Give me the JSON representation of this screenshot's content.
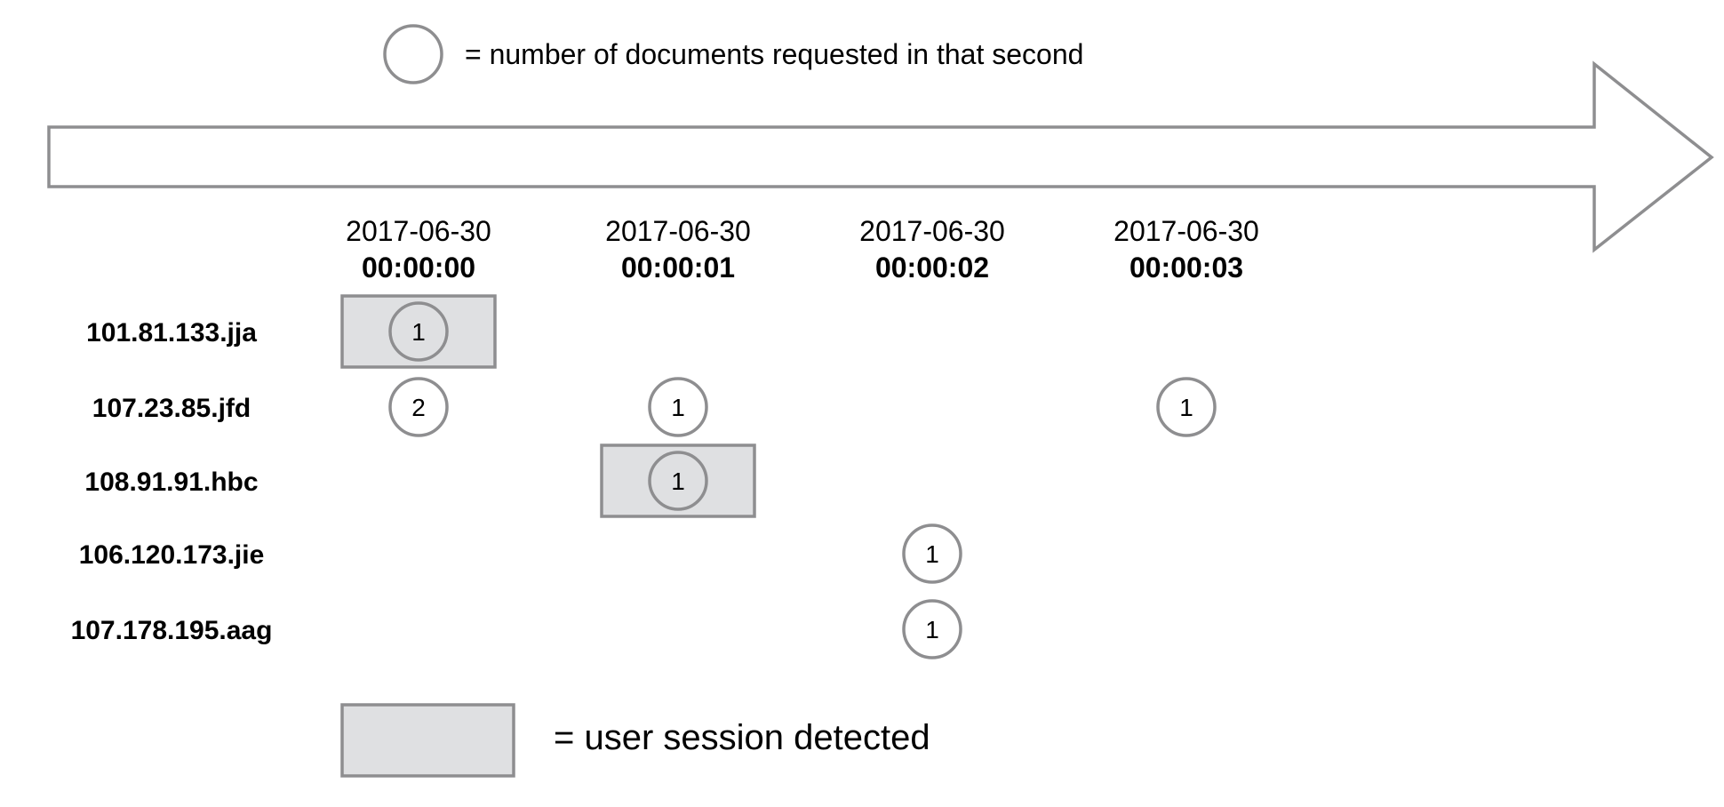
{
  "legend": {
    "circle_text": "= number of documents requested in that second",
    "box_text": "= user session detected"
  },
  "colors": {
    "stroke": "#8e8e90",
    "session_fill": "#dfe0e2",
    "background": "#ffffff"
  },
  "timestamps": [
    {
      "date": "2017-06-30",
      "time": "00:00:00"
    },
    {
      "date": "2017-06-30",
      "time": "00:00:01"
    },
    {
      "date": "2017-06-30",
      "time": "00:00:02"
    },
    {
      "date": "2017-06-30",
      "time": "00:00:03"
    }
  ],
  "rows": [
    {
      "ip": "101.81.133.jja"
    },
    {
      "ip": "107.23.85.jfd"
    },
    {
      "ip": "108.91.91.hbc"
    },
    {
      "ip": "106.120.173.jie"
    },
    {
      "ip": "107.178.195.aag"
    }
  ],
  "requests": [
    {
      "row": 0,
      "time": 0,
      "count": "1",
      "session": true
    },
    {
      "row": 1,
      "time": 0,
      "count": "2",
      "session": false
    },
    {
      "row": 1,
      "time": 1,
      "count": "1",
      "session": false
    },
    {
      "row": 1,
      "time": 3,
      "count": "1",
      "session": false
    },
    {
      "row": 2,
      "time": 1,
      "count": "1",
      "session": true
    },
    {
      "row": 3,
      "time": 2,
      "count": "1",
      "session": false
    },
    {
      "row": 4,
      "time": 2,
      "count": "1",
      "session": false
    }
  ]
}
